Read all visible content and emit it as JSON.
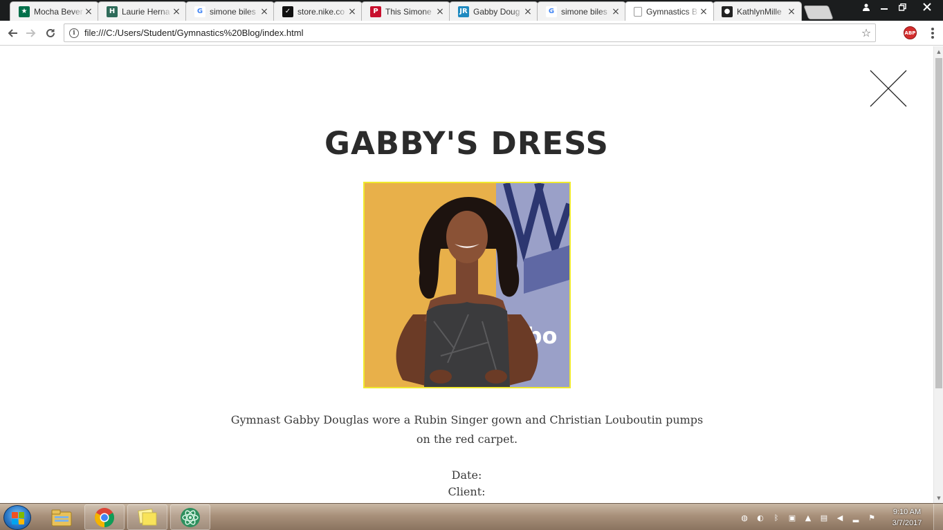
{
  "browser": {
    "tabs": [
      {
        "title": "Mocha Bever",
        "favicon": "starbucks-icon",
        "favicon_color": "#00704a",
        "active": false
      },
      {
        "title": "Laurie Herna",
        "favicon": "h-icon",
        "favicon_color": "#2e6b5a",
        "active": false
      },
      {
        "title": "simone biles",
        "favicon": "google-icon",
        "favicon_color": "#4285f4",
        "active": false
      },
      {
        "title": "store.nike.co",
        "favicon": "nike-icon",
        "favicon_color": "#111111",
        "active": false
      },
      {
        "title": "This Simone",
        "favicon": "people-icon",
        "favicon_color": "#c8102e",
        "active": false
      },
      {
        "title": "Gabby Doug",
        "favicon": "jr-icon",
        "favicon_color": "#1f8ac0",
        "active": false
      },
      {
        "title": "simone biles",
        "favicon": "google-icon",
        "favicon_color": "#4285f4",
        "active": false
      },
      {
        "title": "Gymnastics B",
        "favicon": "page-icon",
        "favicon_color": "#777777",
        "active": true
      },
      {
        "title": "KathlynMille",
        "favicon": "github-icon",
        "favicon_color": "#222222",
        "active": false
      }
    ],
    "url": "file:///C:/Users/Student/Gymnastics%20Blog/index.html",
    "abp_label": "ABP"
  },
  "page": {
    "title": "GABBY'S DRESS",
    "photo_alt": "Gabby Douglas on the red carpet",
    "description": "Gymnast Gabby Douglas wore a Rubin Singer gown and Christian Louboutin pumps on the red carpet.",
    "date_label": "Date:",
    "client_label": "Client:"
  },
  "taskbar": {
    "apps": [
      "explorer-icon",
      "chrome-icon",
      "sticky-notes-icon",
      "atom-icon"
    ],
    "clock_time": "9:10 AM",
    "clock_date": "3/7/2017"
  },
  "colors": {
    "photo_border": "#f0ea2d",
    "title_text": "#2b2b2b",
    "body_text": "#3a3a3a"
  }
}
